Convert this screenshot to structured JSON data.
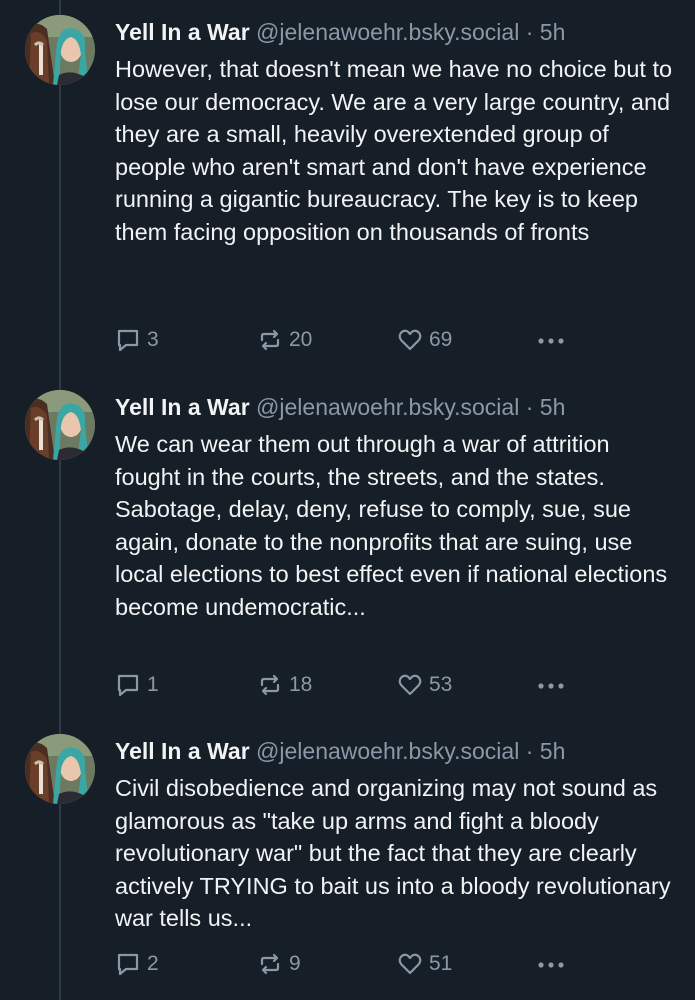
{
  "posts": [
    {
      "author_name": "Yell In a War",
      "handle": "@jelenawoehr.bsky.social",
      "separator": "·",
      "time": "5h",
      "text": "However, that doesn't mean we have no choice but to lose our democracy. We are a very large country, and they are a small, heavily overextended group of people who aren't smart and don't have experience running a gigantic bureaucracy. The key is to keep them facing opposition on thousands of fronts",
      "replies": "3",
      "reposts": "20",
      "likes": "69"
    },
    {
      "author_name": "Yell In a War",
      "handle": "@jelenawoehr.bsky.social",
      "separator": "·",
      "time": "5h",
      "text": "We can wear them out through a war of attrition fought in the courts, the streets, and the states. Sabotage, delay, deny, refuse to comply, sue, sue again, donate to the nonprofits that are suing, use local elections to best effect even if national elections become undemocratic...",
      "replies": "1",
      "reposts": "18",
      "likes": "53"
    },
    {
      "author_name": "Yell In a War",
      "handle": "@jelenawoehr.bsky.social",
      "separator": "·",
      "time": "5h",
      "text": "Civil disobedience and organizing may not sound as glamorous as \"take up arms and fight a bloody revolutionary war\" but the fact that they are clearly actively TRYING to bait us into a bloody revolutionary war tells us...",
      "replies": "2",
      "reposts": "9",
      "likes": "51"
    }
  ],
  "icons": {
    "reply": "reply-icon",
    "repost": "repost-icon",
    "like": "heart-icon",
    "more": "more-icon"
  },
  "colors": {
    "background": "#161e27",
    "text": "#f1f3f5",
    "muted": "#8b98a8",
    "thread_line": "#2e3a48"
  }
}
